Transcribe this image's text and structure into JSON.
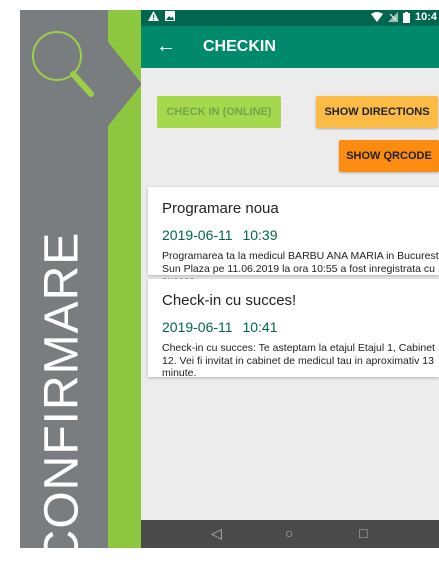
{
  "promo": {
    "vertical_text": "CONFIRMARE"
  },
  "status_bar": {
    "left_icons": [
      "warning-icon",
      "image-icon"
    ],
    "right_icons": [
      "wifi-icon",
      "signal-icon",
      "battery-icon"
    ],
    "time": "10:4"
  },
  "app_bar": {
    "back_icon": "arrow-back-icon",
    "title": "CHECKIN"
  },
  "buttons": {
    "checkin": "CHECK IN (ONLINE)",
    "directions": "SHOW DIRECTIONS",
    "qrcode": "SHOW QRCODE"
  },
  "cards": [
    {
      "title": "Programare noua",
      "date": "2019-06-11 10:39",
      "body": "Programarea ta la medicul BARBU ANA MARIA in Bucuresti Sun Plaza pe 11.06.2019 la ora 10:55 a fost inregistrata cu succes."
    },
    {
      "title": "Check-in cu succes!",
      "date": "2019-06-11 10:41",
      "body": "Check-in cu succes: Te asteptam la etajul Etajul 1, Cabinet 12. Vei fi invitat in cabinet de medicul tau in aproximativ 13 minute."
    }
  ],
  "nav": {
    "back": "◁",
    "home": "○",
    "recents": "□"
  },
  "colors": {
    "status_bar": "#00664d",
    "app_bar": "#00896a",
    "checkin_button": "#a6d84e",
    "directions_button": "#fbbb44",
    "qrcode_button": "#fb8c10",
    "promo_gray": "#7a7d80",
    "promo_green": "#8dc63f"
  }
}
